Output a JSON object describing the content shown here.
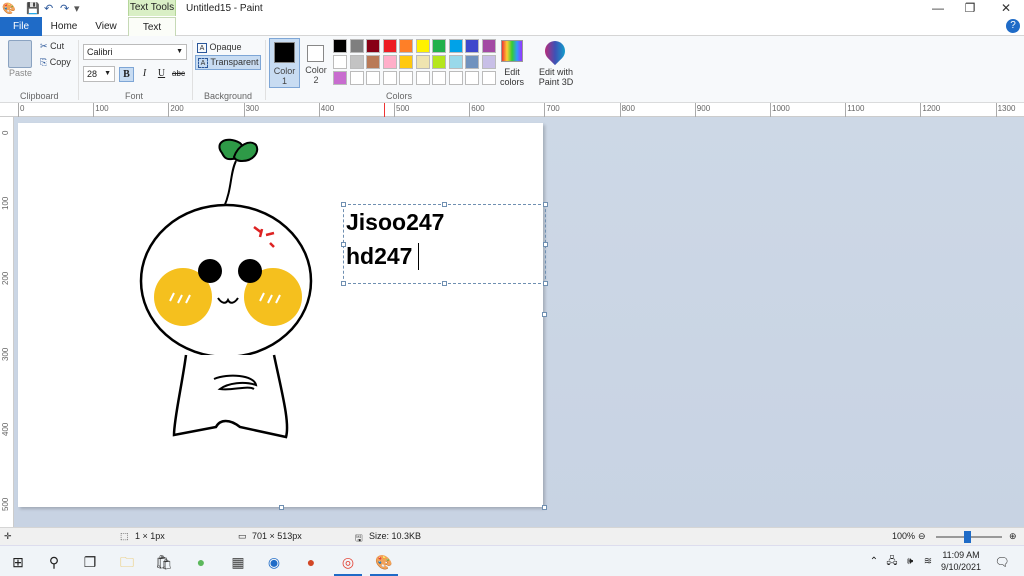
{
  "titlebar": {
    "context_tab": "Text Tools",
    "document_title": "Untitled15 - Paint",
    "minimize": "—",
    "restore": "❐",
    "close": "✕"
  },
  "tabs": {
    "file": "File",
    "home": "Home",
    "view": "View",
    "text": "Text",
    "help": "?"
  },
  "ribbon": {
    "clipboard": {
      "paste": "Paste",
      "cut": "Cut",
      "copy": "Copy",
      "label": "Clipboard"
    },
    "font": {
      "family": "Calibri",
      "size": "28",
      "bold": "B",
      "italic": "I",
      "underline": "U",
      "strike": "abc",
      "label": "Font"
    },
    "background": {
      "opaque": "Opaque",
      "transparent": "Transparent",
      "label": "Background"
    },
    "colors": {
      "color1": "Color\n1",
      "color1_line1": "Color",
      "color1_line2": "1",
      "color2_line1": "Color",
      "color2_line2": "2",
      "edit_colors_line1": "Edit",
      "edit_colors_line2": "colors",
      "paint3d_line1": "Edit with",
      "paint3d_line2": "Paint 3D",
      "label": "Colors",
      "palette_row1": [
        "#000000",
        "#7f7f7f",
        "#880015",
        "#ed1c24",
        "#ff7f27",
        "#fff200",
        "#22b14c",
        "#00a2e8",
        "#3f48cc",
        "#a349a4"
      ],
      "palette_row2": [
        "#ffffff",
        "#c3c3c3",
        "#b97a57",
        "#ffaec9",
        "#ffc90e",
        "#efe4b0",
        "#b5e61d",
        "#99d9ea",
        "#7092be",
        "#c8bfe7"
      ],
      "palette_row3": [
        "#c86ccf",
        "#ffffff",
        "#ffffff",
        "#ffffff",
        "#ffffff",
        "#ffffff",
        "#ffffff",
        "#ffffff",
        "#ffffff",
        "#ffffff"
      ]
    }
  },
  "ruler": {
    "top": [
      "0",
      "100",
      "200",
      "300",
      "400",
      "500",
      "600",
      "700",
      "800",
      "900",
      "1000",
      "1100",
      "1200",
      "1300"
    ],
    "left": [
      "0",
      "100",
      "200",
      "300",
      "400",
      "500"
    ]
  },
  "canvas": {
    "text_line1": "Jisoo247",
    "text_line2": "hd247"
  },
  "statusbar": {
    "cursor": "1 × 1px",
    "dimensions": "701 × 513px",
    "size": "Size: 10.3KB",
    "zoom": "100%"
  },
  "taskbar": {
    "time": "11:09 AM",
    "date": "9/10/2021"
  }
}
